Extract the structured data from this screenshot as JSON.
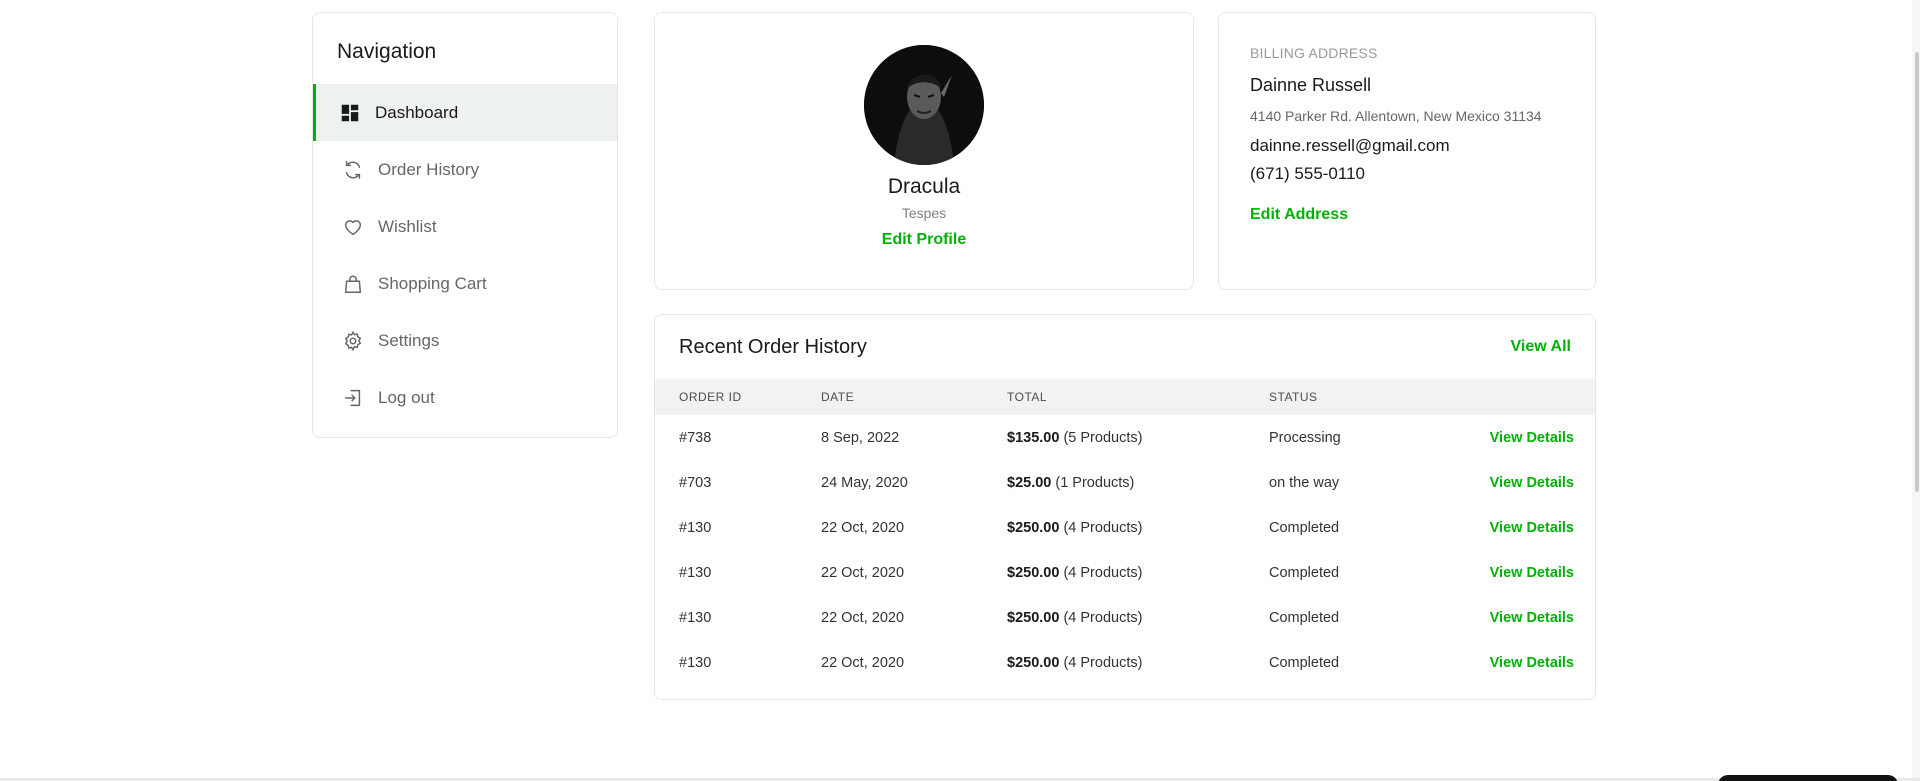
{
  "sidebar": {
    "title": "Navigation",
    "items": [
      {
        "label": "Dashboard",
        "icon": "dashboard-icon",
        "active": true
      },
      {
        "label": "Order History",
        "icon": "refresh-icon"
      },
      {
        "label": "Wishlist",
        "icon": "heart-icon"
      },
      {
        "label": "Shopping Cart",
        "icon": "shopping-bag-icon"
      },
      {
        "label": "Settings",
        "icon": "gear-icon"
      },
      {
        "label": "Log out",
        "icon": "logout-icon"
      }
    ]
  },
  "profile": {
    "name": "Dracula",
    "role": "Tespes",
    "edit_label": "Edit Profile"
  },
  "billing": {
    "label": "BILLING ADDRESS",
    "name": "Dainne Russell",
    "address": "4140 Parker Rd. Allentown, New Mexico 31134",
    "email": "dainne.ressell@gmail.com",
    "phone": "(671) 555-0110",
    "edit_label": "Edit Address"
  },
  "orders": {
    "title": "Recent Order History",
    "view_all": "View All",
    "columns": [
      "ORDER ID",
      "DATE",
      "TOTAL",
      "STATUS"
    ],
    "rows": [
      {
        "id": "#738",
        "date": "8 Sep, 2022",
        "total": "$135.00",
        "products": "(5 Products)",
        "status": "Processing",
        "action": "View Details"
      },
      {
        "id": "#703",
        "date": "24 May, 2020",
        "total": "$25.00",
        "products": "(1 Products)",
        "status": "on the way",
        "action": "View Details"
      },
      {
        "id": "#130",
        "date": "22 Oct, 2020",
        "total": "$250.00",
        "products": "(4 Products)",
        "status": "Completed",
        "action": "View Details"
      },
      {
        "id": "#130",
        "date": "22 Oct, 2020",
        "total": "$250.00",
        "products": "(4 Products)",
        "status": "Completed",
        "action": "View Details"
      },
      {
        "id": "#130",
        "date": "22 Oct, 2020",
        "total": "$250.00",
        "products": "(4 Products)",
        "status": "Completed",
        "action": "View Details"
      },
      {
        "id": "#130",
        "date": "22 Oct, 2020",
        "total": "$250.00",
        "products": "(4 Products)",
        "status": "Completed",
        "action": "View Details"
      }
    ]
  },
  "colors": {
    "accent": "#00b207",
    "active_bg": "#edf2ee",
    "border": "#e6e6e6"
  }
}
